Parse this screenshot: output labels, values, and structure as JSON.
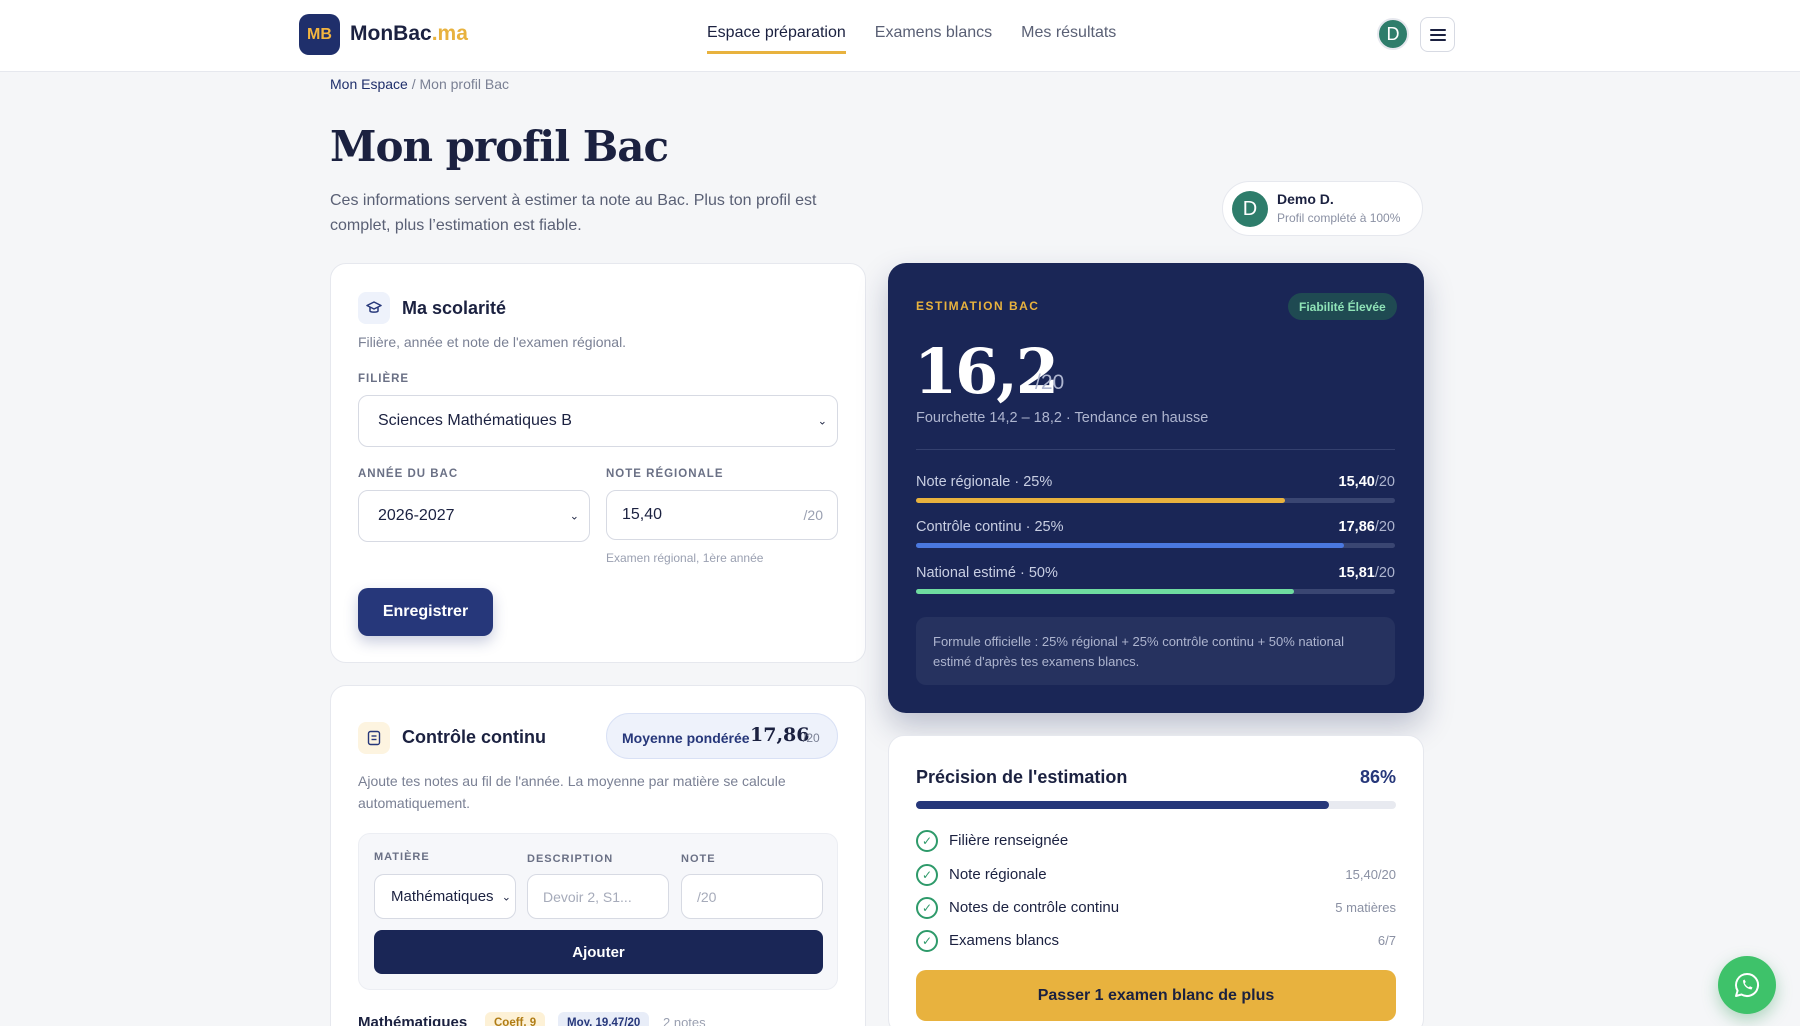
{
  "nav": {
    "logo_initials": "MB",
    "logo_name": "MonBac",
    "logo_tld": ".ma",
    "links": [
      {
        "label": "Espace préparation",
        "active": true
      },
      {
        "label": "Examens blancs",
        "active": false
      },
      {
        "label": "Mes résultats",
        "active": false
      }
    ],
    "avatar_initial": "D",
    "menu_icon": "hamburger-icon"
  },
  "breadcrumb": {
    "root": "Mon Espace",
    "separator": " / ",
    "current": "Mon profil Bac"
  },
  "header": {
    "title": "Mon profil Bac",
    "subtitle": "Ces informations servent à estimer ta note au Bac. Plus ton profil est complet, plus l’estimation est fiable."
  },
  "user": {
    "initial": "D",
    "name": "Demo D.",
    "meta": "Profil complété à 100%"
  },
  "scolarite": {
    "icon": "graduation-cap-icon",
    "title": "Ma scolarité",
    "description": "Filière, année et note de l'examen régional.",
    "filiere_label": "FILIÈRE",
    "filiere_value": "Sciences Mathématiques B",
    "annee_label": "ANNÉE DU BAC",
    "annee_value": "2026-2027",
    "note_label": "NOTE RÉGIONALE",
    "note_value": "15,40",
    "note_suffix": "/20",
    "note_hint": "Examen régional, 1ère année",
    "save_label": "Enregistrer"
  },
  "estimation": {
    "kicker": "ESTIMATION BAC",
    "badge": "Fiabilité Élevée",
    "score": "16,2",
    "score_over": "/20",
    "range": "Fourchette 14,2 – 18,2 · Tendance en hausse",
    "components": [
      {
        "label": "Note régionale · 25%",
        "value": "15,40",
        "over": "/20",
        "fraction": 0.77,
        "color": "#e8b23e"
      },
      {
        "label": "Contrôle continu · 25%",
        "value": "17,86",
        "over": "/20",
        "fraction": 0.893,
        "color": "#4a78e0"
      },
      {
        "label": "National estimé · 50%",
        "value": "15,81",
        "over": "/20",
        "fraction": 0.79,
        "color": "#6fdca0"
      }
    ],
    "formula": "Formule officielle : 25% régional + 25% contrôle continu + 50% national estimé d'après tes examens blancs."
  },
  "precision": {
    "title": "Précision de l'estimation",
    "percent_label": "86%",
    "fraction": 0.86,
    "checks": [
      {
        "label": "Filière renseignée",
        "aside": ""
      },
      {
        "label": "Note régionale",
        "aside": "15,40/20"
      },
      {
        "label": "Notes de contrôle continu",
        "aside": "5 matières"
      },
      {
        "label": "Examens blancs",
        "aside": "6/7"
      }
    ],
    "cta_label": "Passer 1 examen blanc de plus"
  },
  "controle": {
    "icon": "notebook-icon",
    "title": "Contrôle continu",
    "avg_label": "Moyenne pondérée",
    "avg_value": "17,86",
    "avg_over": "/20",
    "description": "Ajoute tes notes au fil de l'année. La moyenne par matière se calcule automatiquement.",
    "matiere_label": "MATIÈRE",
    "matiere_value": "Mathématiques",
    "description_label": "DESCRIPTION",
    "description_placeholder": "Devoir 2, S1...",
    "note_label": "NOTE",
    "note_placeholder": "/20",
    "add_label": "Ajouter",
    "subject": {
      "name": "Mathématiques",
      "coeff": "Coeff. 9",
      "moy": "Moy. 19,47/20",
      "count": "2 notes"
    }
  },
  "colors": {
    "brand": "#1f2f6b",
    "accent": "#e8b23e",
    "dark_card": "#1a2656",
    "success": "#2e9a6a",
    "whatsapp": "#3ec26a"
  },
  "fab": {
    "icon": "whatsapp-icon"
  }
}
